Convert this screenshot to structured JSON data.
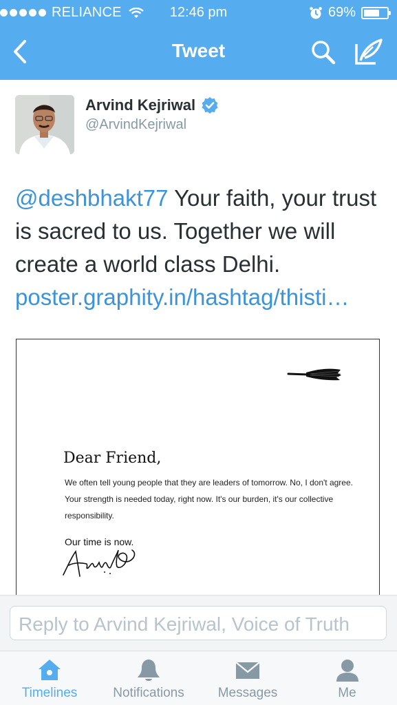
{
  "status_bar": {
    "carrier": "RELIANCE",
    "time": "12:46 pm",
    "battery": "69%",
    "battery_level": 0.69
  },
  "nav": {
    "title": "Tweet"
  },
  "tweet": {
    "author_name": "Arvind Kejriwal",
    "author_handle": "@ArvindKejriwal",
    "mention": "@deshbhakt77",
    "text": " Your faith, your trust is sacred to us. Together we will create a world class Delhi.",
    "link": "poster.graphity.in/hashtag/thisti…"
  },
  "poster": {
    "heading": "Dear Friend,",
    "body": "We often tell young people that they are leaders of tomorrow. No, I don't agree. Your strength is needed today, right now. It's our burden, it's our collective responsibility.",
    "sign_line": "Our time is now."
  },
  "reply": {
    "placeholder": "Reply to Arvind Kejriwal, Voice of Truth"
  },
  "tabs": [
    {
      "label": "Timelines",
      "icon": "home-icon",
      "active": true
    },
    {
      "label": "Notifications",
      "icon": "bell-icon",
      "active": false
    },
    {
      "label": "Messages",
      "icon": "envelope-icon",
      "active": false
    },
    {
      "label": "Me",
      "icon": "person-icon",
      "active": false
    }
  ],
  "colors": {
    "brand": "#55acee",
    "link": "#3b94d9",
    "text": "#292f33",
    "muted": "#8899a6"
  }
}
